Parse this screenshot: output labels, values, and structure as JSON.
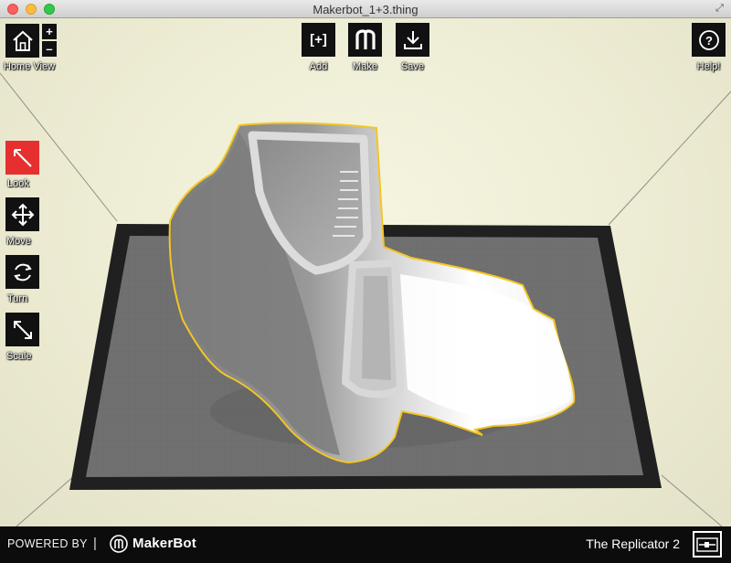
{
  "window": {
    "title": "Makerbot_1+3.thing"
  },
  "toolbar": {
    "home_label": "Home View",
    "zoom_in_label": "+",
    "zoom_out_label": "–",
    "add_label": "Add",
    "add_glyph": "[+]",
    "make_label": "Make",
    "save_label": "Save",
    "help_label": "Help!",
    "help_glyph": "?"
  },
  "modes": [
    {
      "label": "Look",
      "active": true
    },
    {
      "label": "Move",
      "active": false
    },
    {
      "label": "Turn",
      "active": false
    },
    {
      "label": "Scale",
      "active": false
    }
  ],
  "footer": {
    "powered_by": "POWERED BY",
    "separator": "|",
    "brand": "MakerBot",
    "printer_name": "The Replicator 2"
  },
  "icons": {
    "home": "home-icon",
    "make": "makerbot-m-icon",
    "save": "download-icon",
    "help": "question-icon",
    "look": "look-arrow-icon",
    "move": "move-arrows-icon",
    "turn": "rotate-icon",
    "scale": "scale-icon",
    "printer": "printer-icon"
  },
  "colors": {
    "active_mode": "#e5302f",
    "selection_outline": "#f3c623",
    "platform": "#6f6f6f",
    "background": "#ecebd3"
  }
}
